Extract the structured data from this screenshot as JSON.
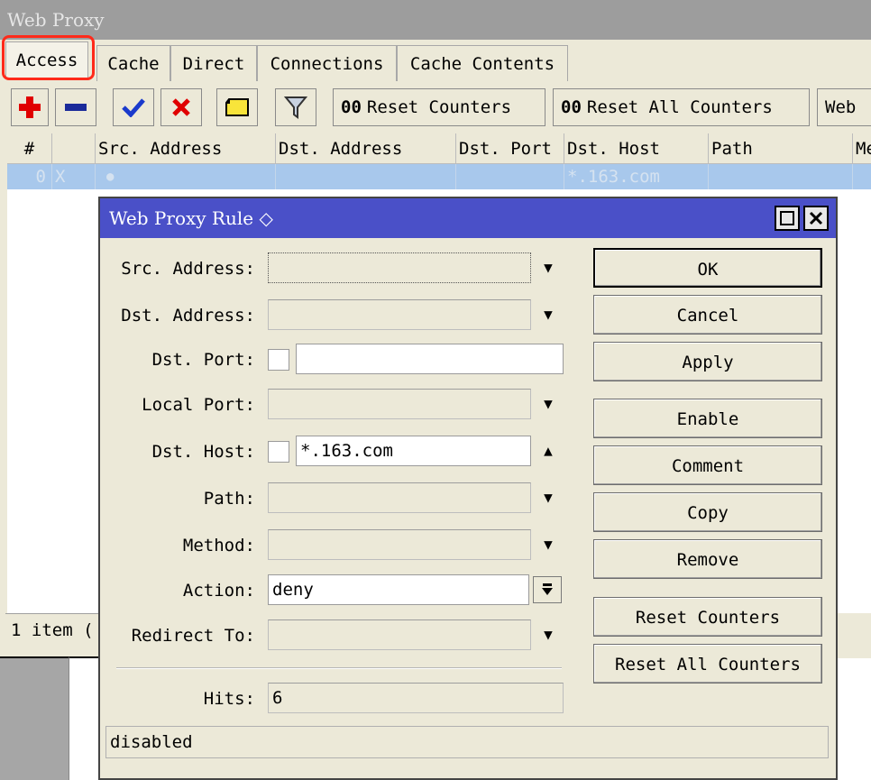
{
  "window": {
    "title": "Web Proxy"
  },
  "tabs": [
    "Access",
    "Cache",
    "Direct",
    "Connections",
    "Cache Contents"
  ],
  "toolbar": {
    "reset_counters": "Reset Counters",
    "reset_all_counters": "Reset All Counters",
    "counter_glyph": "00",
    "web_partial": "Web"
  },
  "table": {
    "columns": [
      "#",
      "",
      "Src. Address",
      "Dst. Address",
      "Dst. Port",
      "Dst. Host",
      "Path",
      "Me"
    ],
    "rows": [
      {
        "num": "0",
        "flag": "X",
        "src": "●",
        "dst_host": "*.163.com"
      }
    ]
  },
  "statusbar": {
    "items": "1 item ("
  },
  "dialog": {
    "title": "Web Proxy Rule ◇",
    "labels": {
      "src_address": "Src. Address:",
      "dst_address": "Dst. Address:",
      "dst_port": "Dst. Port:",
      "local_port": "Local Port:",
      "dst_host": "Dst. Host:",
      "path": "Path:",
      "method": "Method:",
      "action": "Action:",
      "redirect_to": "Redirect To:",
      "hits": "Hits:"
    },
    "values": {
      "src_address": "",
      "dst_address": "",
      "dst_port": "",
      "local_port": "",
      "dst_host": "*.163.com",
      "path": "",
      "method": "",
      "action": "deny",
      "redirect_to": "",
      "hits": "6"
    },
    "buttons": {
      "ok": "OK",
      "cancel": "Cancel",
      "apply": "Apply",
      "enable": "Enable",
      "comment": "Comment",
      "copy": "Copy",
      "remove": "Remove",
      "reset_counters": "Reset Counters",
      "reset_all_counters": "Reset All Counters"
    },
    "status": "disabled"
  },
  "colors": {
    "dialog_title_bg": "#4a50c8",
    "selected_row": "#a8c8ec",
    "highlight_box": "#ff2a1a",
    "window_bg": "#ece9d8"
  }
}
